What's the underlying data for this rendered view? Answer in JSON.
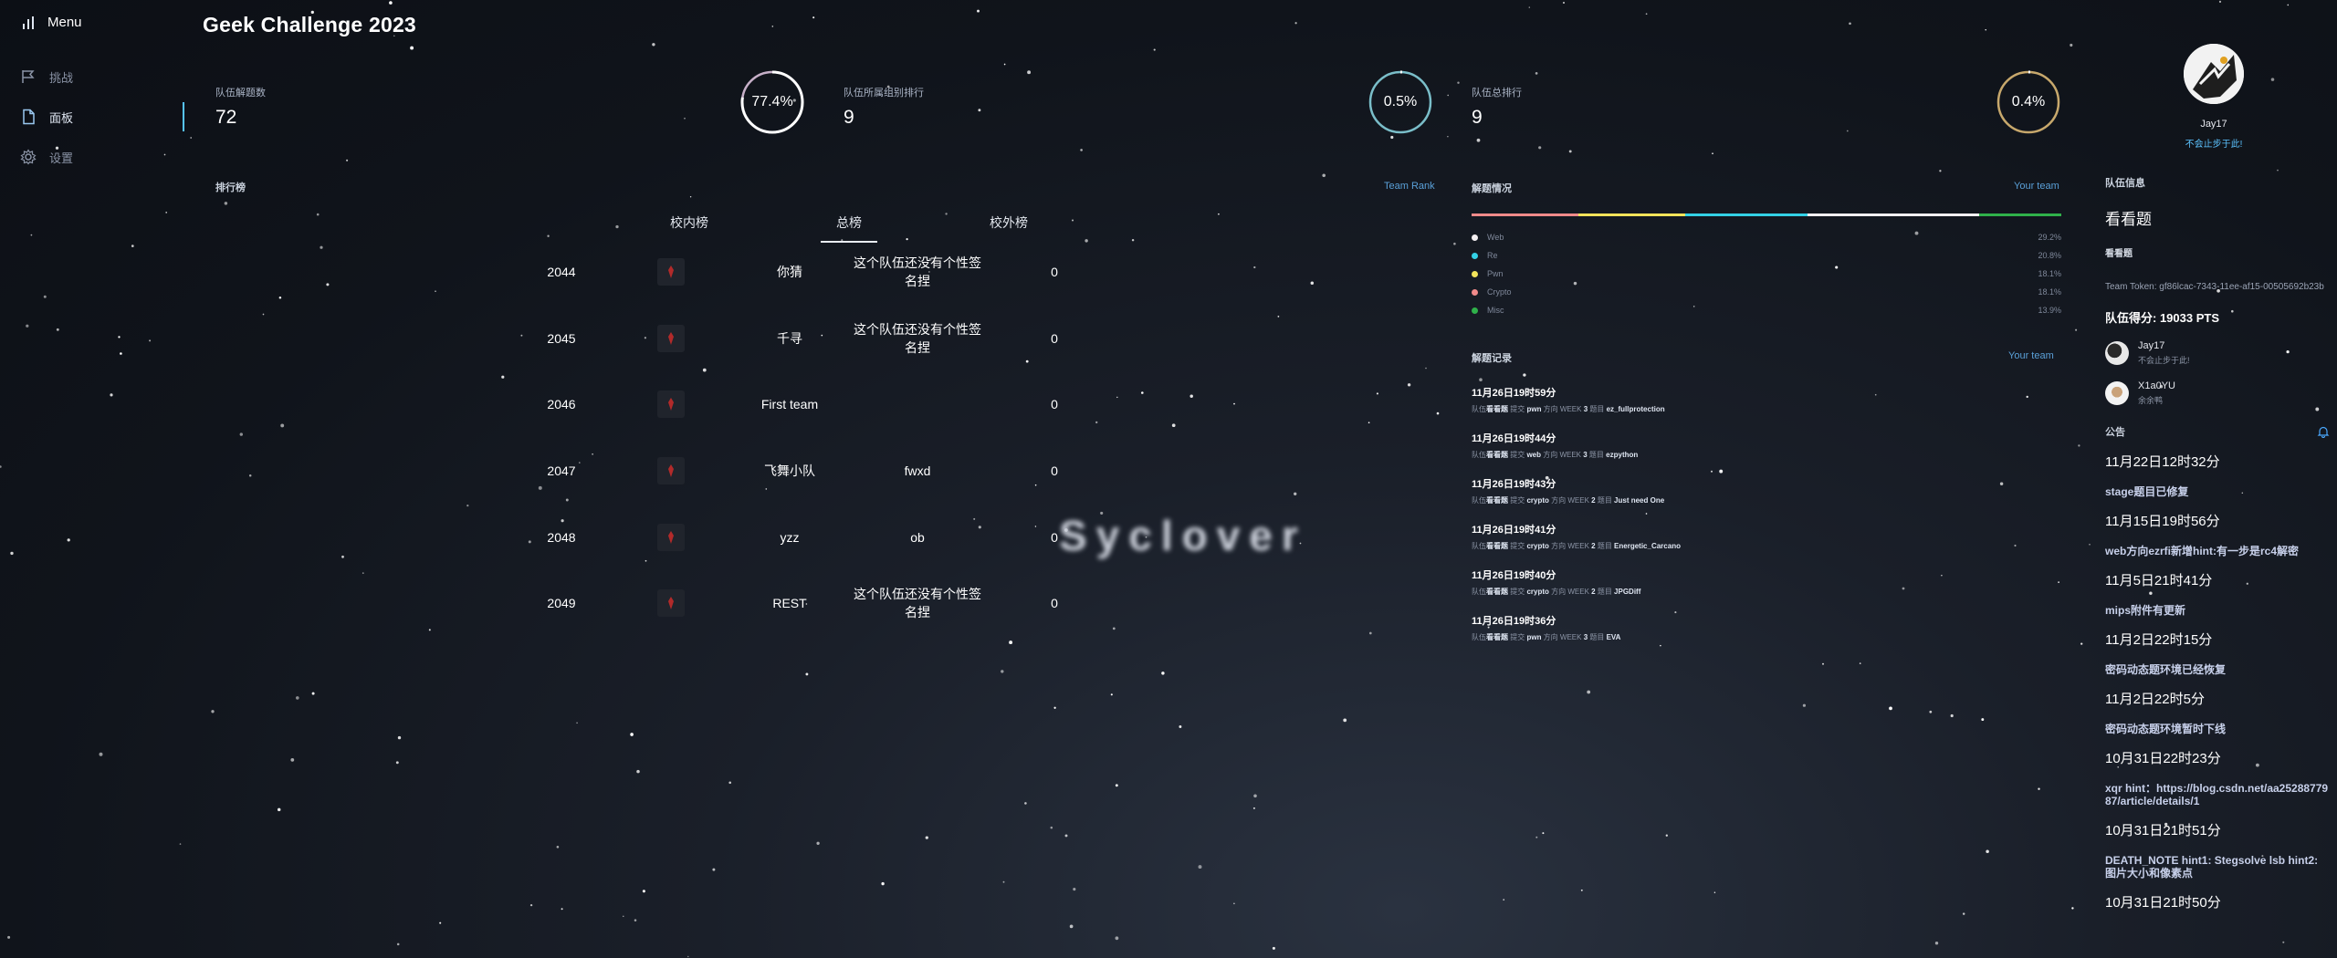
{
  "app": {
    "title": "Geek Challenge 2023"
  },
  "sidebar": {
    "menu_label": "Menu",
    "items": [
      {
        "label": "挑战",
        "icon": "flag-icon",
        "active": false
      },
      {
        "label": "面板",
        "icon": "document-icon",
        "active": true
      },
      {
        "label": "设置",
        "icon": "gear-icon",
        "active": false
      }
    ]
  },
  "stats": [
    {
      "label": "队伍解题数",
      "value": "72",
      "ring_text": "77.4%",
      "ring_percent": 77.4,
      "ring_color": "#e8cbe8"
    },
    {
      "label": "队伍所属组别排行",
      "value": "9",
      "ring_text": "0.5%",
      "ring_percent": 0.5,
      "ring_color": "#8ddce8"
    },
    {
      "label": "队伍总排行",
      "value": "9",
      "ring_text": "0.4%",
      "ring_percent": 0.4,
      "ring_color": "#e8c27a"
    }
  ],
  "ranking": {
    "title": "排行榜",
    "link": "Team Rank",
    "tabs": [
      "校内榜",
      "总榜",
      "校外榜"
    ],
    "active_tab": "总榜",
    "rows": [
      {
        "rank": "2044",
        "name": "你猜",
        "motto": "这个队伍还没有个性签名捏",
        "score": "0"
      },
      {
        "rank": "2045",
        "name": "千寻",
        "motto": "这个队伍还没有个性签名捏",
        "score": "0"
      },
      {
        "rank": "2046",
        "name": "First team",
        "motto": "",
        "score": "0"
      },
      {
        "rank": "2047",
        "name": "飞舞小队",
        "motto": "fwxd",
        "score": "0"
      },
      {
        "rank": "2048",
        "name": "yzz",
        "motto": "ob",
        "score": "0"
      },
      {
        "rank": "2049",
        "name": "REST",
        "motto": "这个队伍还没有个性签名捏",
        "score": "0"
      }
    ]
  },
  "watermark": "Syclover",
  "solve_stats": {
    "title": "解题情况",
    "link": "Your team",
    "categories": [
      {
        "name": "Web",
        "percent": "29.2%",
        "value": 29.2,
        "color": "#f4f0f2"
      },
      {
        "name": "Re",
        "percent": "20.8%",
        "value": 20.8,
        "color": "#33d1e6"
      },
      {
        "name": "Pwn",
        "percent": "18.1%",
        "value": 18.1,
        "color": "#f2e35a"
      },
      {
        "name": "Crypto",
        "percent": "18.1%",
        "value": 18.1,
        "color": "#f08a8a"
      },
      {
        "name": "Misc",
        "percent": "13.9%",
        "value": 13.9,
        "color": "#2fb14a"
      }
    ],
    "bar_order": [
      "Crypto",
      "Pwn",
      "Re",
      "Web",
      "Misc"
    ]
  },
  "records": {
    "title": "解题记录",
    "link": "Your team",
    "items": [
      {
        "time": "11月26日19时59分",
        "team": "看看题",
        "user": "pwn",
        "rank": "3",
        "challenge": "ez_fullprotection"
      },
      {
        "time": "11月26日19时44分",
        "team": "看看题",
        "user": "web",
        "rank": "3",
        "challenge": "ezpython"
      },
      {
        "time": "11月26日19时43分",
        "team": "看看题",
        "user": "crypto",
        "rank": "2",
        "challenge": "Just need One"
      },
      {
        "time": "11月26日19时41分",
        "team": "看看题",
        "user": "crypto",
        "rank": "2",
        "challenge": "Energetic_Carcano"
      },
      {
        "time": "11月26日19时40分",
        "team": "看看题",
        "user": "crypto",
        "rank": "2",
        "challenge": "JPGDiff"
      },
      {
        "time": "11月26日19时36分",
        "team": "看看题",
        "user": "pwn",
        "rank": "3",
        "challenge": "EVA"
      }
    ],
    "labels": {
      "prefix": "队伍",
      "submit": "提交",
      "direction": "方向",
      "ranking": "WEEK",
      "solved": "题目"
    }
  },
  "user": {
    "name": "Jay17",
    "subtitle": "不会止步于此!"
  },
  "team_panel": {
    "label": "队伍信息",
    "team_name": "看看题",
    "team_sub": "看看题",
    "token": "Team Token: gf86lcac-7343-11ee-af15-00505692b23b",
    "points": "队伍得分: 19033 PTS",
    "members": [
      {
        "name": "Jay17",
        "sub": "不会止步于此!"
      },
      {
        "name": "X1a0YU",
        "sub": "余余鸭"
      }
    ]
  },
  "announcements": {
    "label": "公告",
    "items": [
      {
        "date": "11月22日12时32分",
        "text": "stage题目已修复"
      },
      {
        "date": "11月15日19时56分",
        "text": "web方向ezrfi新增hint:有一步是rc4解密"
      },
      {
        "date": "11月5日21时41分",
        "text": "mips附件有更新"
      },
      {
        "date": "11月2日22时15分",
        "text": "密码动态题环境已经恢复"
      },
      {
        "date": "11月2日22时5分",
        "text": "密码动态题环境暂时下线"
      },
      {
        "date": "10月31日22时23分",
        "text": "xqr hint：https://blog.csdn.net/aa2528877987/article/details/1"
      },
      {
        "date": "10月31日21时51分",
        "text": "DEATH_NOTE hint1: Stegsolve lsb hint2: 图片大小和像素点"
      },
      {
        "date": "10月31日21时50分",
        "text": ""
      }
    ]
  }
}
